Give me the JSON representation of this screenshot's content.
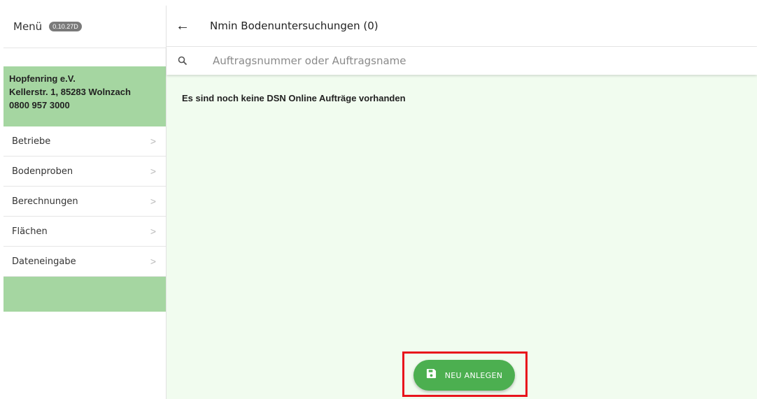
{
  "sidebar": {
    "title": "Menü",
    "version": "0.10.27D",
    "org": {
      "name": "Hopfenring e.V.",
      "address": "Kellerstr. 1, 85283 Wolnzach",
      "phone": "0800 957 3000"
    },
    "items": [
      {
        "label": "Betriebe"
      },
      {
        "label": "Bodenproben"
      },
      {
        "label": "Berechnungen"
      },
      {
        "label": "Flächen"
      },
      {
        "label": "Dateneingabe"
      }
    ]
  },
  "header": {
    "title": "Nmin Bodenuntersuchungen (0)"
  },
  "search": {
    "placeholder": "Auftragsnummer oder Auftragsname",
    "value": ""
  },
  "main": {
    "empty_message": "Es sind noch keine DSN Online Aufträge vorhanden"
  },
  "fab": {
    "label": "NEU ANLEGEN"
  },
  "colors": {
    "accent_green": "#4caf50",
    "sidebar_green": "#a5d6a1",
    "content_bg": "#f1fcef",
    "highlight_red": "#e8141c"
  }
}
